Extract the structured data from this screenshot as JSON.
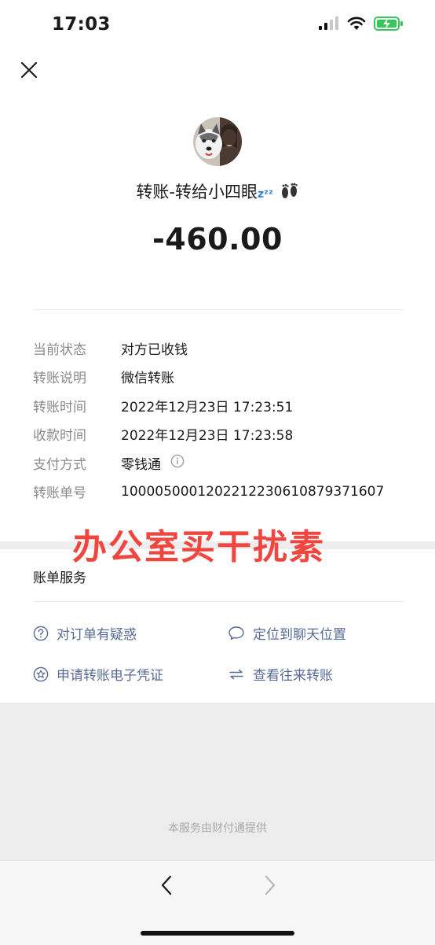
{
  "status_bar": {
    "time": "17:03"
  },
  "header": {
    "title": "转账-转给小四眼",
    "title_suffix": "zᶻᶻ",
    "amount": "-460.00"
  },
  "details": [
    {
      "label": "当前状态",
      "value": "对方已收钱"
    },
    {
      "label": "转账说明",
      "value": "微信转账"
    },
    {
      "label": "转账时间",
      "value": "2022年12月23日 17:23:51"
    },
    {
      "label": "收款时间",
      "value": "2022年12月23日 17:23:58"
    },
    {
      "label": "支付方式",
      "value": "零钱通"
    },
    {
      "label": "转账单号",
      "value": "1000050001202212230610879371607"
    }
  ],
  "watermark": "办公室买干扰素",
  "services": {
    "title": "账单服务",
    "items": [
      {
        "label": "对订单有疑惑",
        "icon": "question-circle-icon"
      },
      {
        "label": "定位到聊天位置",
        "icon": "chat-bubble-icon"
      },
      {
        "label": "申请转账电子凭证",
        "icon": "star-circle-icon"
      },
      {
        "label": "查看往来转账",
        "icon": "swap-arrows-icon"
      }
    ]
  },
  "footer": {
    "provider": "本服务由财付通提供"
  },
  "colors": {
    "link": "#576b95",
    "watermark": "#f0463f",
    "label": "#8a8a8a",
    "emoji_blue": "#2f7fe0"
  }
}
